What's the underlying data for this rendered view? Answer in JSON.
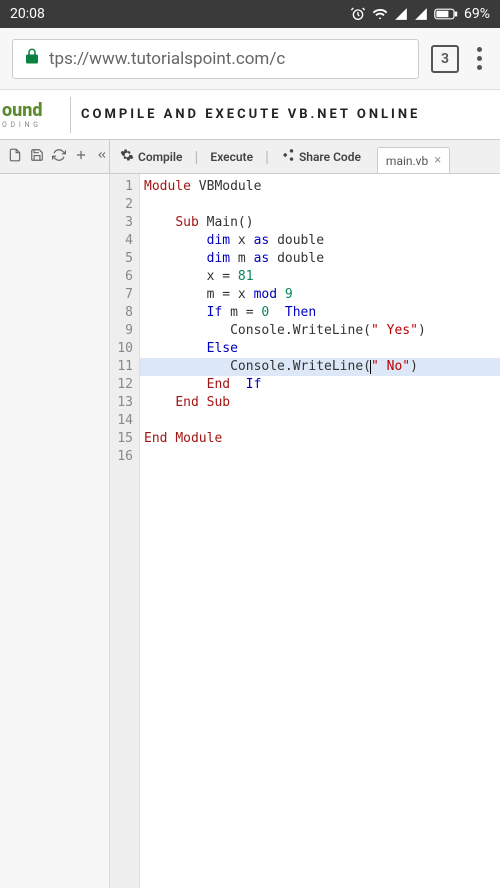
{
  "status": {
    "time": "20:08",
    "battery": "69%"
  },
  "browser": {
    "url": "tps://www.tutorialspoint.com/c",
    "tab_count": "3"
  },
  "site": {
    "logo_fragment": "ound",
    "logo_sub": "O D I N G",
    "title": "COMPILE AND EXECUTE VB.NET ONLINE"
  },
  "toolbar": {
    "compile": "Compile",
    "execute": "Execute",
    "share": "Share Code",
    "filename": "main.vb"
  },
  "code": {
    "lines": [
      {
        "n": "1",
        "segs": [
          {
            "t": "Module",
            "c": "kw-red"
          },
          {
            "t": " VBModule",
            "c": "ident"
          }
        ]
      },
      {
        "n": "2",
        "segs": []
      },
      {
        "n": "3",
        "segs": [
          {
            "t": "    ",
            "c": ""
          },
          {
            "t": "Sub",
            "c": "kw-red"
          },
          {
            "t": " Main()",
            "c": "ident"
          }
        ]
      },
      {
        "n": "4",
        "segs": [
          {
            "t": "        ",
            "c": ""
          },
          {
            "t": "dim",
            "c": "kw-blue"
          },
          {
            "t": " x ",
            "c": "ident"
          },
          {
            "t": "as",
            "c": "kw-blue"
          },
          {
            "t": " double",
            "c": "ident"
          }
        ]
      },
      {
        "n": "5",
        "segs": [
          {
            "t": "        ",
            "c": ""
          },
          {
            "t": "dim",
            "c": "kw-blue"
          },
          {
            "t": " m ",
            "c": "ident"
          },
          {
            "t": "as",
            "c": "kw-blue"
          },
          {
            "t": " double",
            "c": "ident"
          }
        ]
      },
      {
        "n": "6",
        "segs": [
          {
            "t": "        x = ",
            "c": "ident"
          },
          {
            "t": "81",
            "c": "num"
          }
        ]
      },
      {
        "n": "7",
        "segs": [
          {
            "t": "        m = x ",
            "c": "ident"
          },
          {
            "t": "mod",
            "c": "kw-blue"
          },
          {
            "t": " ",
            "c": ""
          },
          {
            "t": "9",
            "c": "num"
          }
        ]
      },
      {
        "n": "8",
        "segs": [
          {
            "t": "        ",
            "c": ""
          },
          {
            "t": "If",
            "c": "kw-blue"
          },
          {
            "t": " m = ",
            "c": "ident"
          },
          {
            "t": "0",
            "c": "num"
          },
          {
            "t": "  ",
            "c": ""
          },
          {
            "t": "Then",
            "c": "kw-blue"
          }
        ]
      },
      {
        "n": "9",
        "segs": [
          {
            "t": "           Console.WriteLine(",
            "c": "ident"
          },
          {
            "t": "\" Yes\"",
            "c": "str-red"
          },
          {
            "t": ")",
            "c": "ident"
          }
        ]
      },
      {
        "n": "10",
        "segs": [
          {
            "t": "        ",
            "c": ""
          },
          {
            "t": "Else",
            "c": "kw-blue"
          }
        ]
      },
      {
        "n": "11",
        "hl": true,
        "cursor_after": 2,
        "segs": [
          {
            "t": "           Console.W",
            "c": "ident"
          },
          {
            "t": "riteLine(",
            "c": "ident"
          },
          {
            "t": "\" No\"",
            "c": "str-red"
          },
          {
            "t": ")",
            "c": "ident"
          }
        ]
      },
      {
        "n": "12",
        "segs": [
          {
            "t": "        ",
            "c": ""
          },
          {
            "t": "End",
            "c": "kw-red"
          },
          {
            "t": "  ",
            "c": ""
          },
          {
            "t": "If",
            "c": "kw-blue"
          }
        ]
      },
      {
        "n": "13",
        "segs": [
          {
            "t": "    ",
            "c": ""
          },
          {
            "t": "End",
            "c": "kw-red"
          },
          {
            "t": " ",
            "c": ""
          },
          {
            "t": "Sub",
            "c": "kw-red"
          }
        ]
      },
      {
        "n": "14",
        "segs": []
      },
      {
        "n": "15",
        "segs": [
          {
            "t": "End",
            "c": "kw-red"
          },
          {
            "t": " ",
            "c": ""
          },
          {
            "t": "Module",
            "c": "kw-red"
          }
        ]
      },
      {
        "n": "16",
        "segs": []
      }
    ]
  }
}
